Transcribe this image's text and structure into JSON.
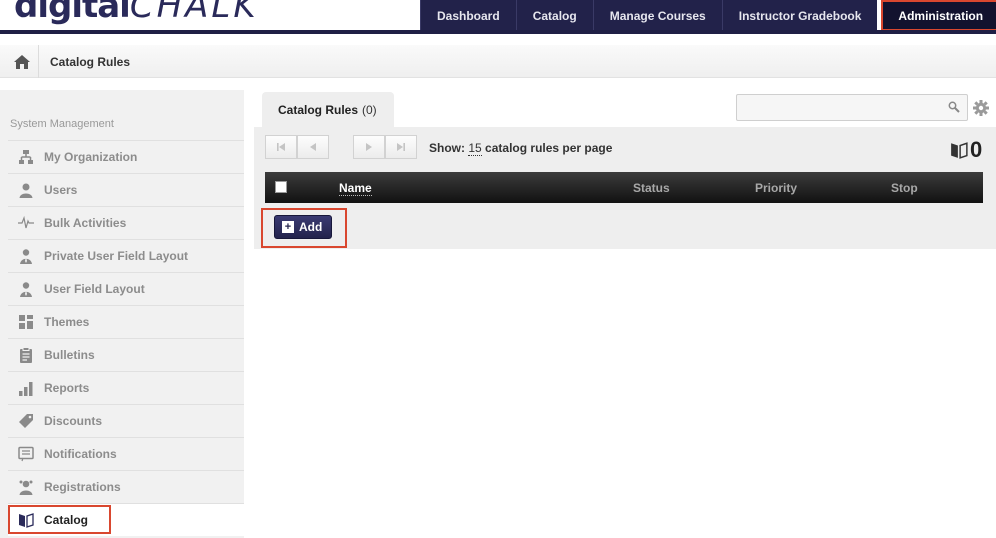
{
  "header": {
    "logo_main": "digital",
    "logo_sub": "CHALK",
    "nav": [
      {
        "label": "Dashboard"
      },
      {
        "label": "Catalog"
      },
      {
        "label": "Manage Courses"
      },
      {
        "label": "Instructor Gradebook"
      },
      {
        "label": "Administration",
        "active": true
      }
    ]
  },
  "breadcrumb": {
    "home_icon": "home-icon",
    "title": "Catalog Rules"
  },
  "sidebar": {
    "heading": "System Management",
    "items": [
      {
        "label": "My Organization",
        "icon": "org-chart-icon"
      },
      {
        "label": "Users",
        "icon": "user-icon"
      },
      {
        "label": "Bulk Activities",
        "icon": "pulse-icon"
      },
      {
        "label": "Private User Field Layout",
        "icon": "user-field-icon"
      },
      {
        "label": "User Field Layout",
        "icon": "user-field-icon"
      },
      {
        "label": "Themes",
        "icon": "themes-grid-icon"
      },
      {
        "label": "Bulletins",
        "icon": "clipboard-icon"
      },
      {
        "label": "Reports",
        "icon": "bar-chart-icon"
      },
      {
        "label": "Discounts",
        "icon": "tag-icon"
      },
      {
        "label": "Notifications",
        "icon": "message-icon"
      },
      {
        "label": "Registrations",
        "icon": "registrations-icon"
      },
      {
        "label": "Catalog",
        "icon": "book-icon",
        "active": true
      }
    ]
  },
  "main": {
    "tab": {
      "label": "Catalog Rules",
      "count": "(0)"
    },
    "search": {
      "placeholder": "",
      "value": ""
    },
    "pager": {
      "show_label": "Show:",
      "per_page": "15",
      "suffix": "catalog rules per page"
    },
    "total_count": "0",
    "table": {
      "columns": [
        "Name",
        "Status",
        "Priority",
        "Stop"
      ],
      "rows": []
    },
    "add_label": "Add"
  },
  "colors": {
    "nav_bg": "#22224a",
    "highlight": "#d9472f",
    "table_header": "#1a1a1a"
  }
}
